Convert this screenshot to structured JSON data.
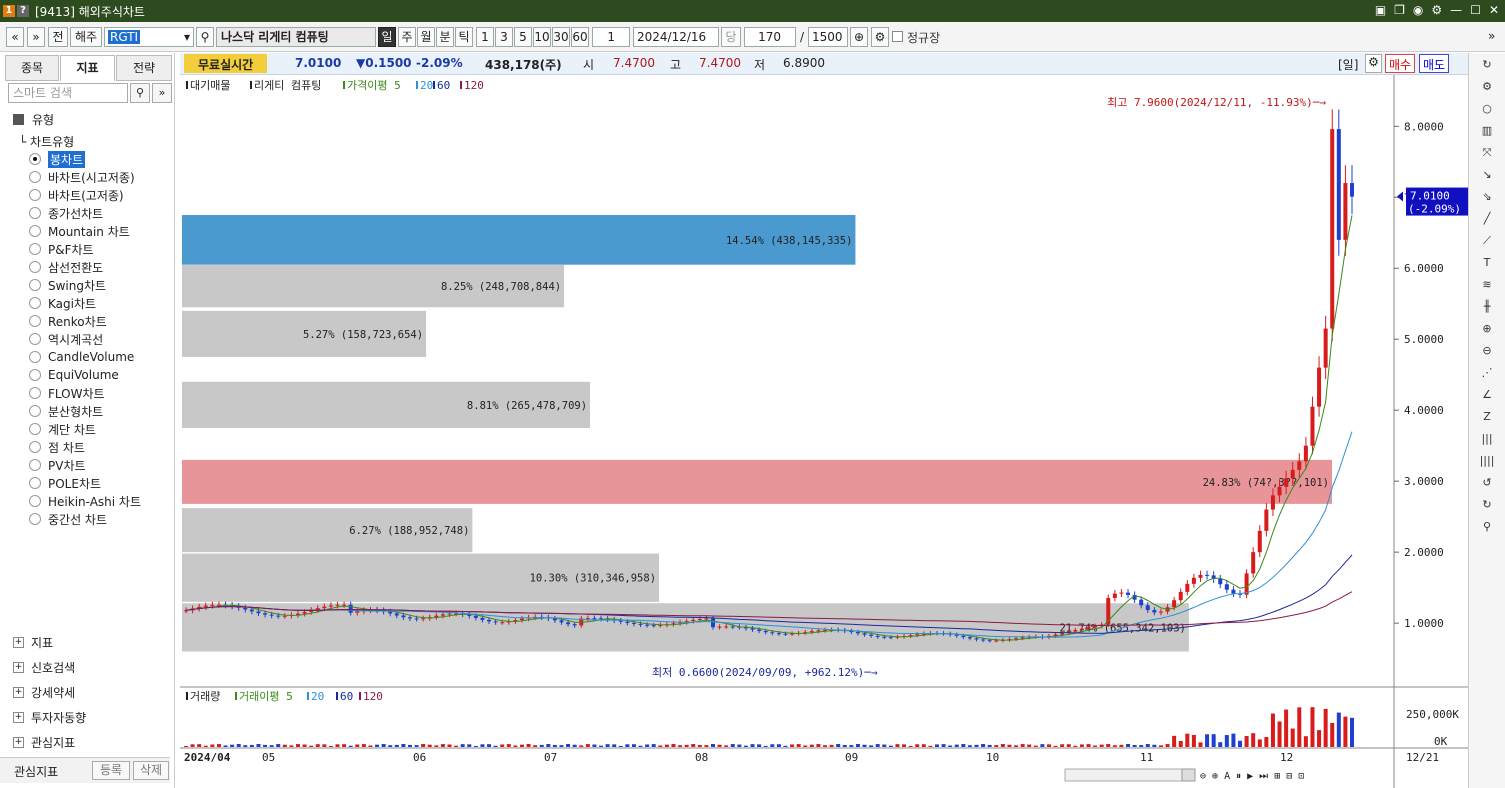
{
  "window": {
    "title": "[9413] 해외주식차트",
    "icons": [
      "1",
      "?"
    ]
  },
  "toolbar": {
    "nav_prev": "«",
    "nav_down": "»",
    "prev_label": "전",
    "market": "해주",
    "symbol": "RGTI",
    "company": "나스닥   리게티 컴퓨팅",
    "periods": [
      "일",
      "주",
      "월",
      "분",
      "틱"
    ],
    "active_period": "일",
    "intervals": [
      "1",
      "3",
      "5",
      "10",
      "30",
      "60"
    ],
    "count1": "1",
    "date": "2024/12/16",
    "dang": "당",
    "bars": "170",
    "slash": "/",
    "max_bars": "1500",
    "checkbox_label": "정규장"
  },
  "sidebar": {
    "tabs": [
      "종목",
      "지표",
      "전략"
    ],
    "active_tab": "지표",
    "search_placeholder": "스마트 검색",
    "section": "유형",
    "chart_type_label": "차트유형",
    "chart_types": [
      "봉차트",
      "바차트(시고저종)",
      "바차트(고저종)",
      "종가선차트",
      "Mountain 차트",
      "P&F차트",
      "삼선전환도",
      "Swing차트",
      "Kagi차트",
      "Renko차트",
      "역시계곡선",
      "CandleVolume",
      "EquiVolume",
      "FLOW차트",
      "분산형차트",
      "계단 차트",
      "점 차트",
      "PV차트",
      "POLE차트",
      "Heikin-Ashi 차트",
      "중간선 차트"
    ],
    "selected_type": "봉차트",
    "groups": [
      "지표",
      "신호검색",
      "강세약세",
      "투자자동향",
      "관심지표"
    ],
    "footer_label": "관심지표",
    "footer_buttons": [
      "등록",
      "삭제"
    ]
  },
  "quote": {
    "realtime": "무료실시간",
    "price": "7.0100",
    "change": "▼0.1500",
    "pct": "-2.09%",
    "volume": "438,178(주)",
    "open_label": "시",
    "open": "7.4700",
    "high_label": "고",
    "high": "7.4700",
    "low_label": "저",
    "low": "6.8900",
    "period_tag": "[일]",
    "buy": "매수",
    "sell": "매도"
  },
  "colors": {
    "up": "#d81b1b",
    "down": "#1f3fd0",
    "ma5": "#3a8a1a",
    "ma20": "#2f8fd8",
    "ma60": "#1a2a9a",
    "ma120": "#8a1a4a",
    "blue_bar": "#4a9ad0",
    "red_bar": "#e8959a",
    "grey_bar": "#c8c8c8"
  },
  "chart_data": {
    "type": "candlestick",
    "legend": [
      "대기매물",
      "리게티 컴퓨팅",
      "가격이평 5",
      "20",
      "60",
      "120"
    ],
    "y_ticks": [
      "8.0000",
      "7.0000",
      "6.0000",
      "5.0000",
      "4.0000",
      "3.0000",
      "2.0000",
      "1.0000"
    ],
    "ylim": [
      0.1,
      8.3
    ],
    "x_labels": [
      "2024/04",
      "05",
      "06",
      "07",
      "08",
      "09",
      "10",
      "11",
      "12",
      "12/21"
    ],
    "current_label": "7.0100",
    "current_change": "(-2.09%)",
    "high_note": "최고 7.9600(2024/12/11, -11.93%)",
    "low_note": "최저 0.6600(2024/09/09, +962.12%)",
    "volume_profile": [
      {
        "low": 6.05,
        "high": 6.75,
        "pct": "14.54%",
        "shares": "438,145,335",
        "label": "14.54% (438,145,335)",
        "ratio": 14.54,
        "color": "blue"
      },
      {
        "low": 5.45,
        "high": 6.05,
        "pct": "8.25%",
        "shares": "248,708,844",
        "label": "8.25% (248,708,844)",
        "ratio": 8.25,
        "color": "grey"
      },
      {
        "low": 4.75,
        "high": 5.4,
        "pct": "5.27%",
        "shares": "158,723,654",
        "label": "5.27% (158,723,654)",
        "ratio": 5.27,
        "color": "grey"
      },
      {
        "low": 3.75,
        "high": 4.4,
        "pct": "8.81%",
        "shares": "265,478,709",
        "label": "8.81% (265,478,709)",
        "ratio": 8.81,
        "color": "grey"
      },
      {
        "low": 2.68,
        "high": 3.3,
        "pct": "24.83%",
        "shares": "74?,3??,101",
        "label": "24.83% (74?,3??,101)",
        "ratio": 24.83,
        "color": "red"
      },
      {
        "low": 2.0,
        "high": 2.62,
        "pct": "6.27%",
        "shares": "188,952,748",
        "label": "6.27% (188,952,748)",
        "ratio": 6.27,
        "color": "grey"
      },
      {
        "low": 1.3,
        "high": 1.98,
        "pct": "10.30%",
        "shares": "310,346,958",
        "label": "10.30% (310,346,958)",
        "ratio": 10.3,
        "color": "grey"
      },
      {
        "low": 0.6,
        "high": 1.28,
        "pct": "21.74%",
        "shares": "655,342,103",
        "label": "21.74% (655,342,103)",
        "ratio": 21.74,
        "color": "grey"
      }
    ],
    "volume_legend": [
      "거래량",
      "거래이평 5",
      "20",
      "60",
      "120"
    ],
    "volume_ticks": [
      "250,000K",
      "0K"
    ]
  }
}
